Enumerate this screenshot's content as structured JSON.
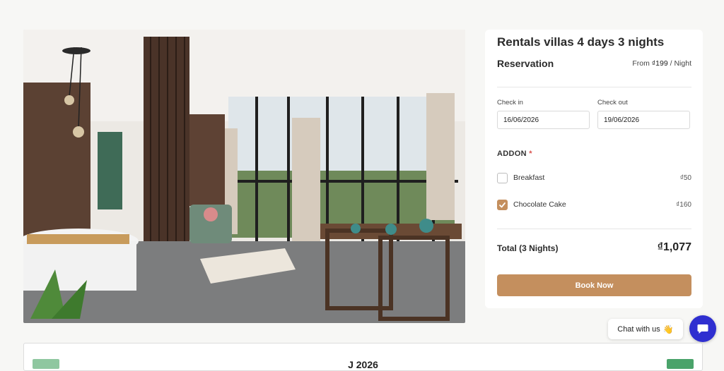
{
  "listing": {
    "title": "Rentals villas 4 days 3 nights"
  },
  "reservation": {
    "label": "Reservation",
    "from_prefix": "From",
    "from_price": "₫199",
    "from_suffix": "/ Night",
    "check_in_label": "Check in",
    "check_in_value": "16/06/2026",
    "check_out_label": "Check out",
    "check_out_value": "19/06/2026"
  },
  "addon": {
    "title": "ADDON",
    "required_mark": "*",
    "items": [
      {
        "name": "Breakfast",
        "price": "₫50",
        "checked": false
      },
      {
        "name": "Chocolate Cake",
        "price": "₫160",
        "checked": true
      }
    ]
  },
  "total": {
    "label": "Total (3 Nights)",
    "value": "₫1,077"
  },
  "book_button": "Book Now",
  "chat": {
    "bubble_text": "Chat with us",
    "wave_emoji": "👋",
    "button_icon": "chat-icon",
    "button_color": "#2f2fd0"
  },
  "colors": {
    "accent": "#c48f5e",
    "page_background": "#f7f7f5"
  },
  "bottom_panel": {
    "title": "J    2026"
  }
}
